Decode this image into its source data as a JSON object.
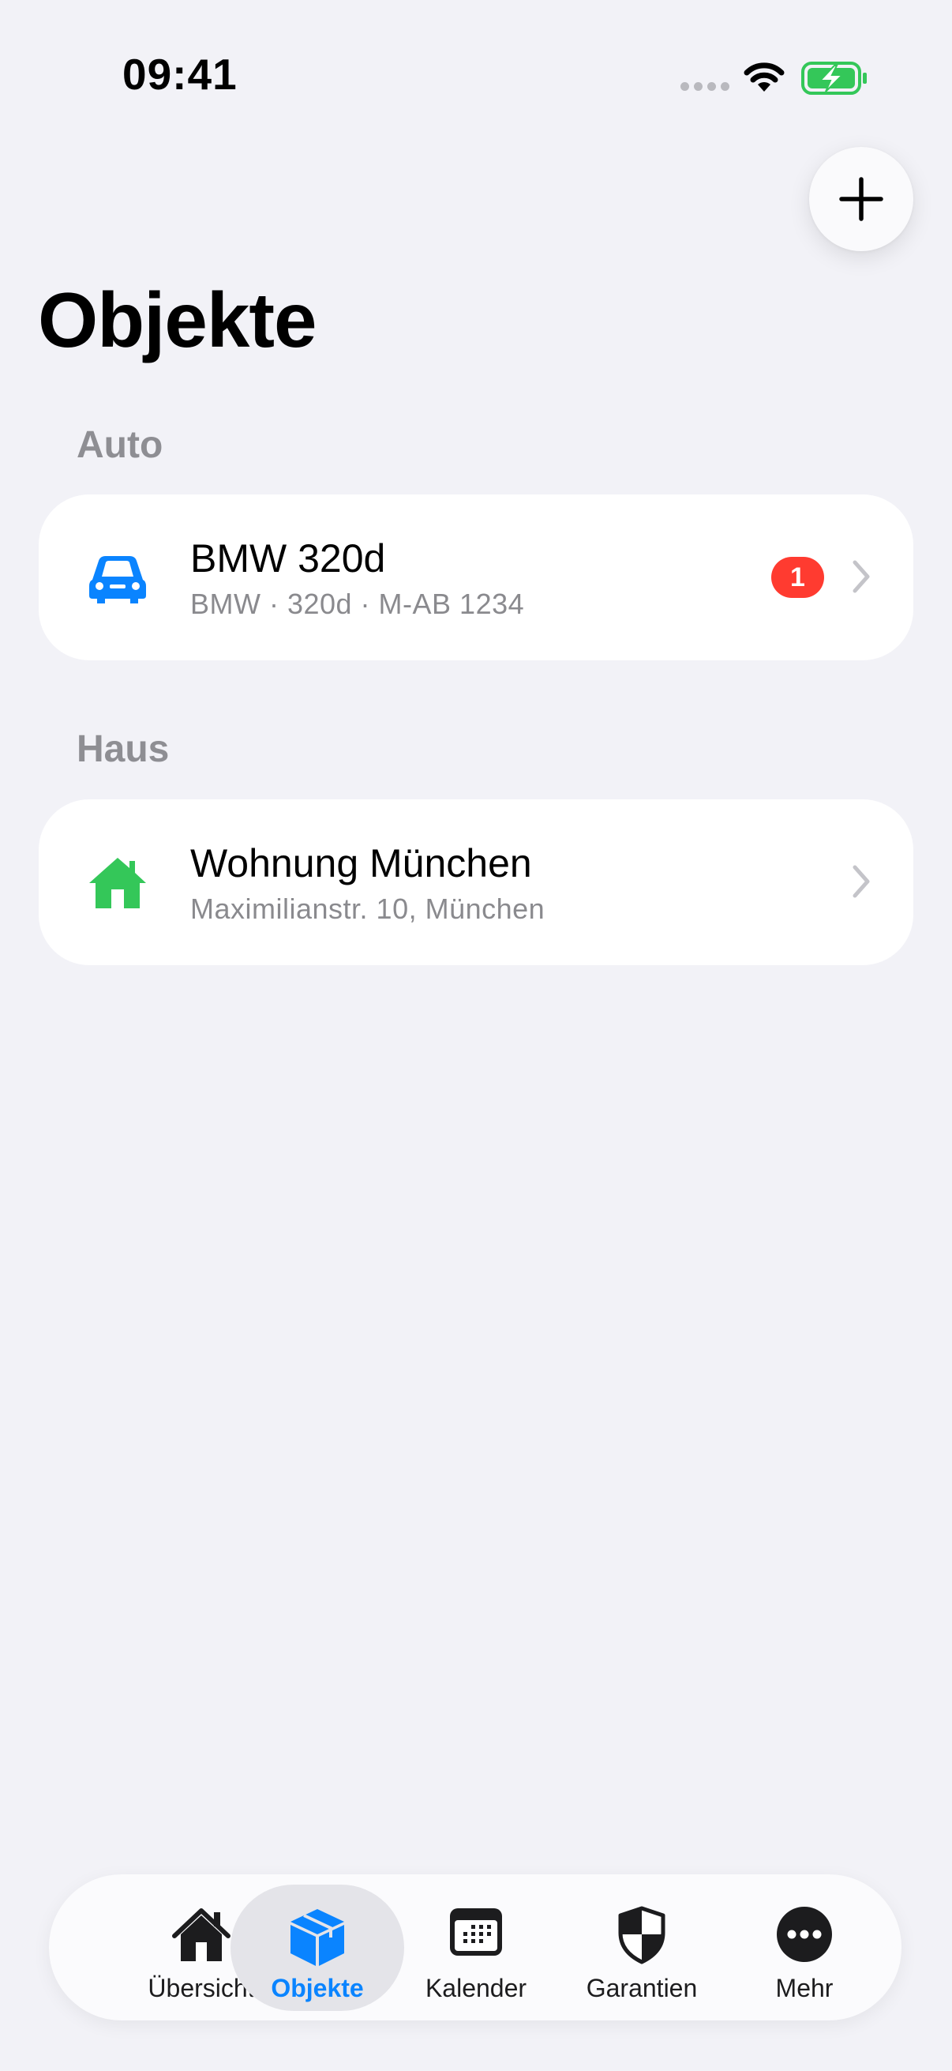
{
  "status_bar": {
    "time": "09:41",
    "icons": [
      "signal-dots-icon",
      "wifi-icon",
      "battery-charging-icon"
    ],
    "battery_color": "#34c759"
  },
  "header": {
    "add_icon": "plus-icon",
    "title": "Objekte"
  },
  "sections": [
    {
      "header": "Auto",
      "items": [
        {
          "icon": "car-icon",
          "icon_color": "#0a84ff",
          "title": "BMW 320d",
          "subtitle": "BMW · 320d · M-AB 1234",
          "badge": "1",
          "badge_color": "#ff3b30"
        }
      ]
    },
    {
      "header": "Haus",
      "items": [
        {
          "icon": "house-icon",
          "icon_color": "#34c759",
          "title": "Wohnung München",
          "subtitle": "Maximilianstr. 10, München"
        }
      ]
    }
  ],
  "tab_bar": {
    "accent_color": "#0a84ff",
    "active_tab": "Objekte",
    "tabs": [
      {
        "label": "Übersicht",
        "icon": "house-icon"
      },
      {
        "label": "Objekte",
        "icon": "cube-icon"
      },
      {
        "label": "Kalender",
        "icon": "calendar-icon"
      },
      {
        "label": "Garantien",
        "icon": "shield-icon"
      },
      {
        "label": "Mehr",
        "icon": "ellipsis-circle-icon"
      }
    ]
  }
}
